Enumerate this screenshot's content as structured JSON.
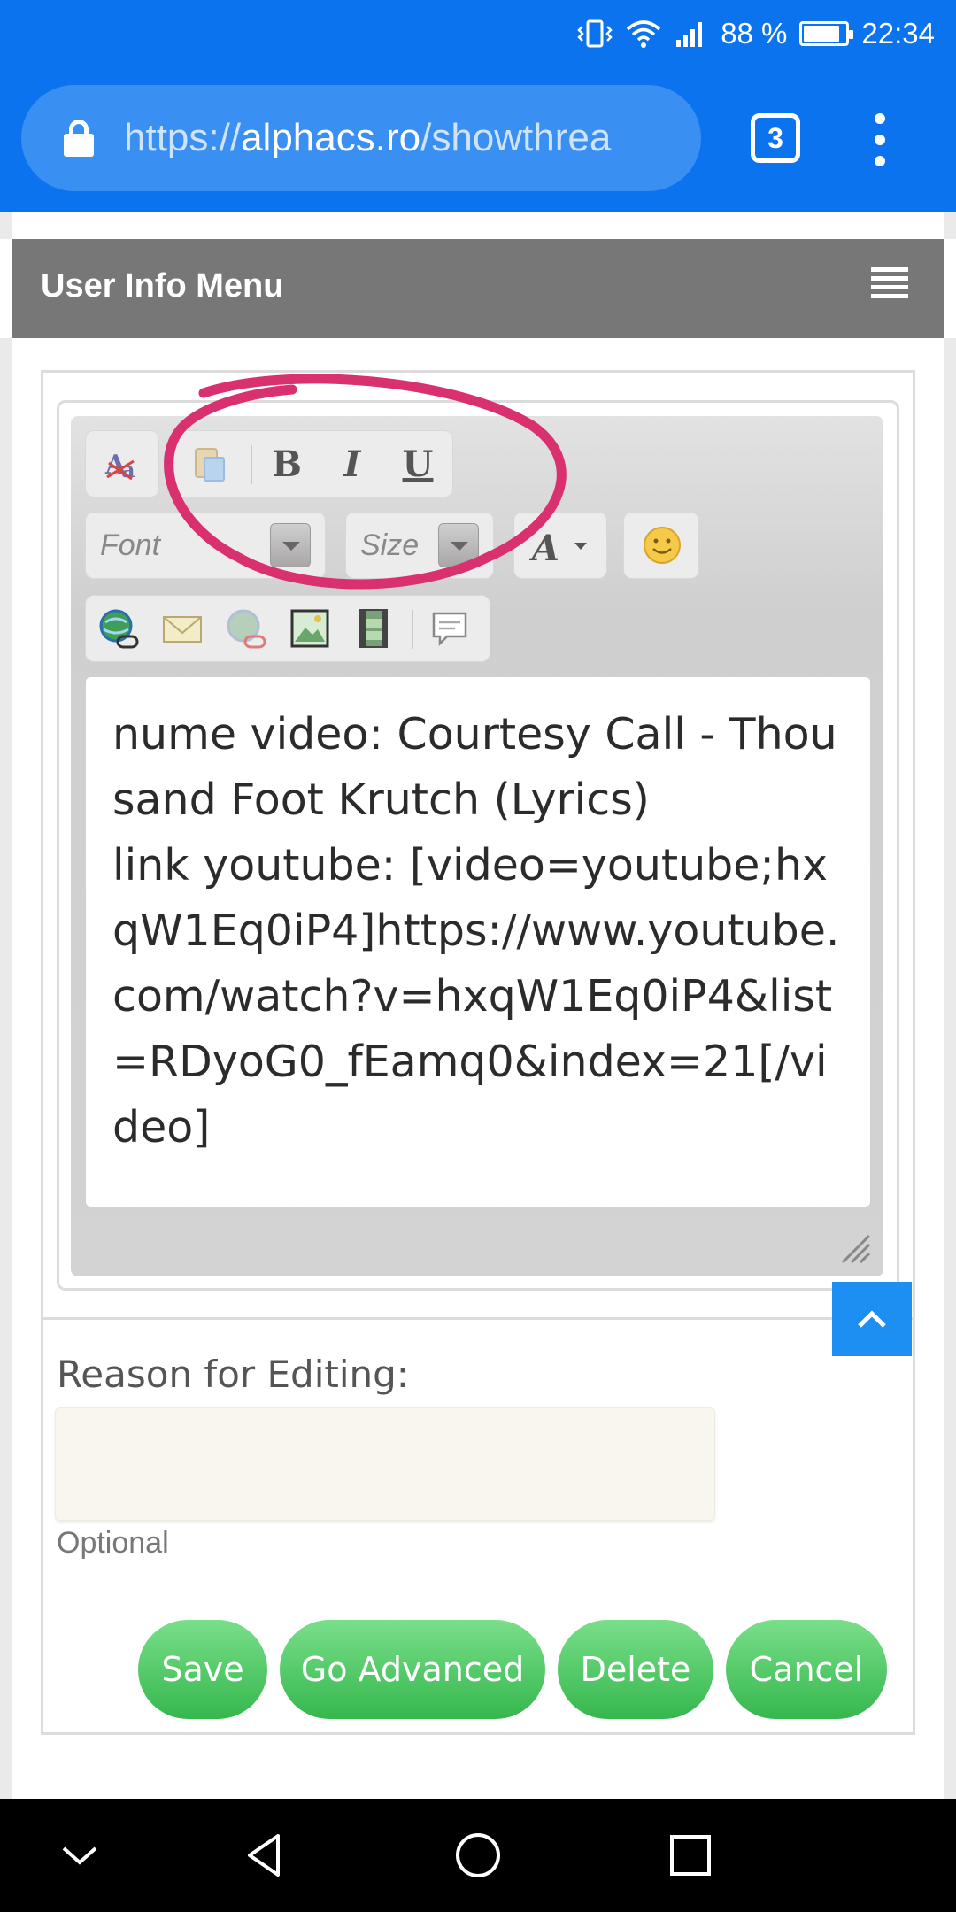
{
  "status_bar": {
    "battery": "88 %",
    "battery_level": 0.88,
    "time": "22:34"
  },
  "browser": {
    "url_scheme": "https://",
    "url_host": "alphacs.ro",
    "url_path": "/showthrea",
    "tab_count": "3"
  },
  "header": {
    "title": "User Info Menu"
  },
  "toolbar": {
    "bold": "B",
    "italic": "I",
    "underline": "U",
    "font_placeholder": "Font",
    "size_placeholder": "Size"
  },
  "editor": {
    "content": "nume video: Courtesy Call - Thousand Foot Krutch (Lyrics)\nlink youtube: [video=youtube;hxqW1Eq0iP4]https://www.youtube.com/watch?v=hxqW1Eq0iP4&list=RDyoG0_fEamq0&index=21[/video]"
  },
  "form": {
    "reason_label": "Reason for Editing:",
    "optional_note": "Optional",
    "save_label": "Save",
    "go_advanced_label": "Go Advanced",
    "delete_label": "Delete",
    "cancel_label": "Cancel"
  },
  "colors": {
    "browser_blue": "#0a73ed",
    "header_gray": "#777777",
    "button_green": "#35b74d",
    "annotation_pink": "#d9306f",
    "scroll_button_blue": "#1e8ff2"
  },
  "icons": [
    "vibrate-icon",
    "wifi-icon",
    "signal-icon",
    "battery-icon",
    "lock-icon",
    "tabs-icon",
    "overflow-menu-icon",
    "hamburger-icon",
    "remove-format-icon",
    "paste-icon",
    "font-color-icon",
    "smiley-icon",
    "insert-link-icon",
    "insert-email-icon",
    "remove-link-icon",
    "insert-image-icon",
    "insert-video-icon",
    "insert-quote-icon",
    "resize-grip-icon",
    "chevron-up-icon",
    "nav-collapse-icon",
    "nav-back-icon",
    "nav-home-icon",
    "nav-recents-icon"
  ]
}
